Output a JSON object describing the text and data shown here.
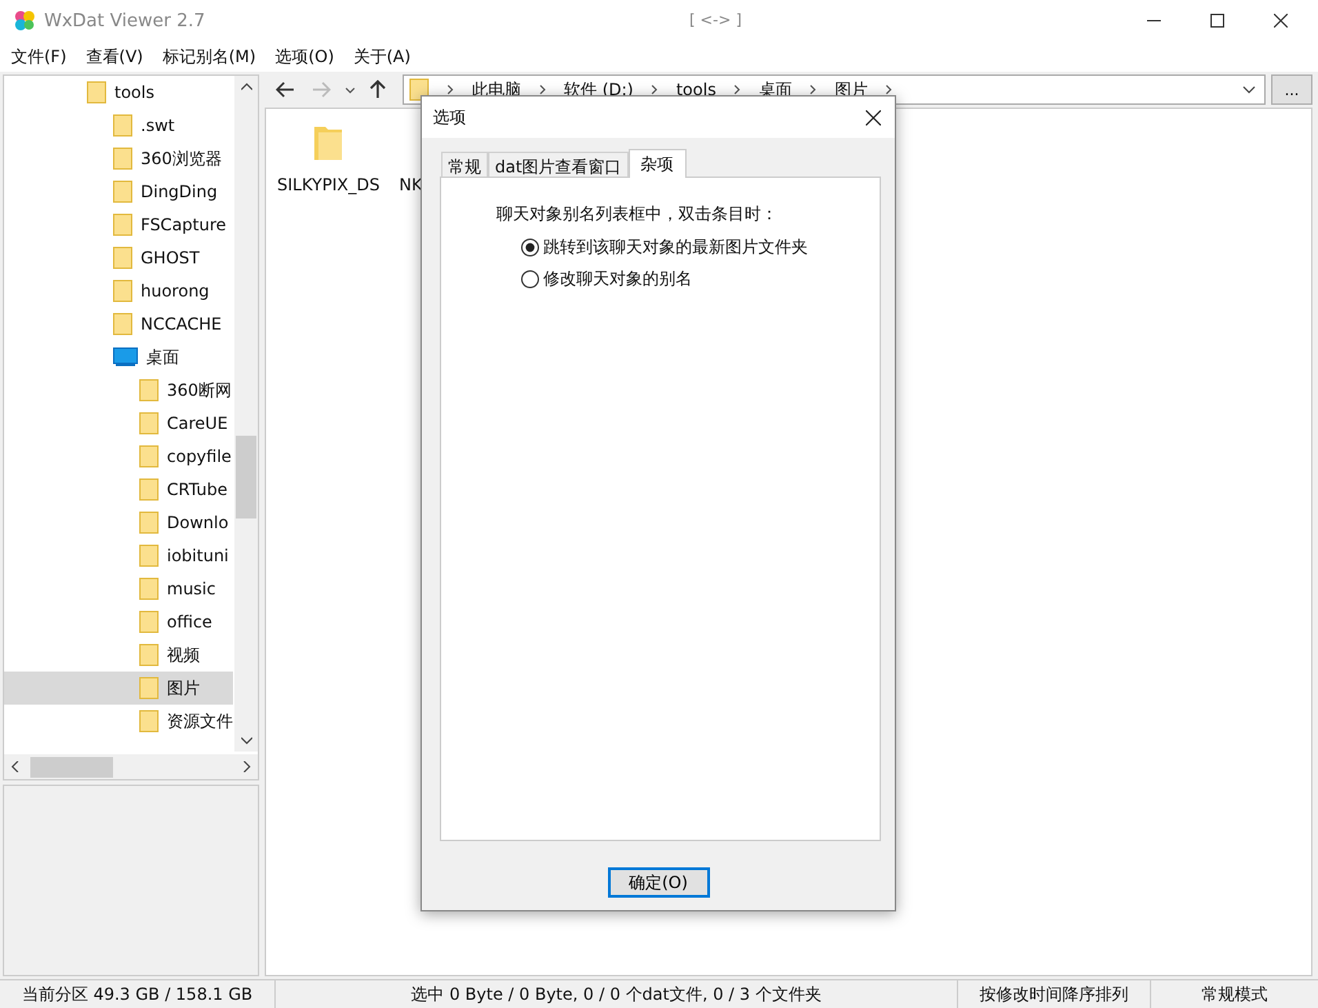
{
  "window": {
    "title": "WxDat Viewer 2.7",
    "center_title": "[ <-> ]"
  },
  "menu": [
    {
      "label": "文件(F)"
    },
    {
      "label": "查看(V)"
    },
    {
      "label": "标记别名(M)"
    },
    {
      "label": "选项(O)"
    },
    {
      "label": "关于(A)"
    }
  ],
  "tree": [
    {
      "label": "tools",
      "kind": "folder",
      "selected": false,
      "children": [
        {
          "label": ".swt",
          "kind": "folder",
          "selected": false
        },
        {
          "label": "360浏览器",
          "kind": "folder",
          "selected": false
        },
        {
          "label": "DingDing",
          "kind": "folder",
          "selected": false
        },
        {
          "label": "FSCapture",
          "kind": "folder",
          "selected": false
        },
        {
          "label": "GHOST",
          "kind": "folder",
          "selected": false
        },
        {
          "label": "huorong",
          "kind": "folder",
          "selected": false
        },
        {
          "label": "NCCACHE",
          "kind": "folder",
          "selected": false
        },
        {
          "label": "桌面",
          "kind": "desktop",
          "selected": false,
          "children": [
            {
              "label": "360断网",
              "kind": "folder",
              "selected": false
            },
            {
              "label": "CareUE",
              "kind": "folder",
              "selected": false
            },
            {
              "label": "copyfile",
              "kind": "folder",
              "selected": false
            },
            {
              "label": "CRTube",
              "kind": "folder",
              "selected": false
            },
            {
              "label": "Downlo",
              "kind": "folder",
              "selected": false
            },
            {
              "label": "iobituni",
              "kind": "folder",
              "selected": false
            },
            {
              "label": "music",
              "kind": "folder",
              "selected": false
            },
            {
              "label": "office",
              "kind": "folder",
              "selected": false
            },
            {
              "label": "视频",
              "kind": "folder",
              "selected": false
            },
            {
              "label": "图片",
              "kind": "folder",
              "selected": true
            },
            {
              "label": "资源文件",
              "kind": "folder",
              "selected": false
            }
          ]
        }
      ]
    }
  ],
  "address": {
    "crumbs": [
      "此电脑",
      "软件 (D:)",
      "tools",
      "桌面",
      "图片"
    ],
    "browse_button": "..."
  },
  "files": [
    {
      "label": "SILKYPIX_DS",
      "kind": "folder"
    },
    {
      "label": "NK",
      "kind": "hidden"
    }
  ],
  "dialog": {
    "title": "选项",
    "tabs": [
      {
        "label": "常规",
        "selected": false
      },
      {
        "label": "dat图片查看窗口",
        "selected": false
      },
      {
        "label": "杂项",
        "selected": true
      }
    ],
    "prompt": "聊天对象别名列表框中，双击条目时：",
    "options": [
      {
        "label": "跳转到该聊天对象的最新图片文件夹",
        "selected": true
      },
      {
        "label": "修改聊天对象的别名",
        "selected": false
      }
    ],
    "ok": "确定(O)"
  },
  "status_bar": [
    "当前分区 49.3 GB / 158.1 GB",
    "选中 0 Byte / 0 Byte, 0 / 0 个dat文件, 0 / 3 个文件夹",
    "按修改时间降序排列",
    "常规模式"
  ]
}
